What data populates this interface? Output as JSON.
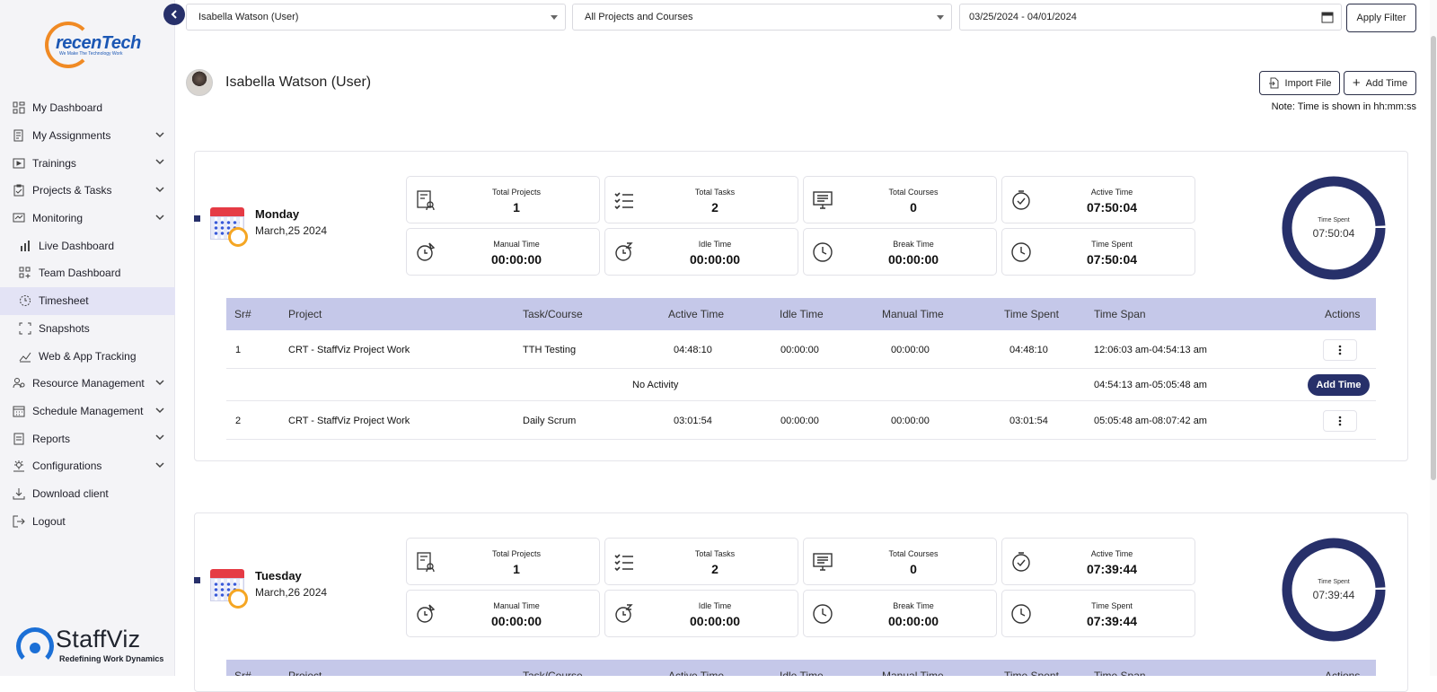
{
  "brand": {
    "logo_text": "recenTech",
    "logo_tagline": "We Make The Technology Work",
    "footer_name": "StaffViz",
    "footer_tagline": "Redefining Work Dynamics"
  },
  "sidebar": {
    "items": [
      {
        "label": "My Dashboard",
        "icon": "dashboard-icon"
      },
      {
        "label": "My Assignments",
        "icon": "assignments-icon"
      },
      {
        "label": "Trainings",
        "icon": "play-icon"
      },
      {
        "label": "Projects & Tasks",
        "icon": "clipboard-icon"
      },
      {
        "label": "Monitoring",
        "icon": "monitor-icon"
      },
      {
        "label": "Live Dashboard",
        "icon": "bar-chart-icon"
      },
      {
        "label": "Team Dashboard",
        "icon": "grid-plus-icon"
      },
      {
        "label": "Timesheet",
        "icon": "timer-icon"
      },
      {
        "label": "Snapshots",
        "icon": "crop-icon"
      },
      {
        "label": "Web & App Tracking",
        "icon": "tracking-icon"
      },
      {
        "label": "Resource Management",
        "icon": "people-icon"
      },
      {
        "label": "Schedule Management",
        "icon": "calendar-icon"
      },
      {
        "label": "Reports",
        "icon": "report-icon"
      },
      {
        "label": "Configurations",
        "icon": "config-icon"
      },
      {
        "label": "Download client",
        "icon": "download-icon"
      },
      {
        "label": "Logout",
        "icon": "logout-icon"
      }
    ]
  },
  "filters": {
    "user": "Isabella Watson (User)",
    "project": "All Projects and Courses",
    "date_range": "03/25/2024 - 04/01/2024",
    "apply_label": "Apply Filter"
  },
  "header": {
    "user_name": "Isabella Watson (User)",
    "import_label": "Import File",
    "add_label": "Add Time",
    "note": "Note: Time is shown in hh:mm:ss"
  },
  "stat_labels": {
    "projects": "Total Projects",
    "tasks": "Total Tasks",
    "courses": "Total Courses",
    "active": "Active Time",
    "manual": "Manual Time",
    "idle": "Idle Time",
    "break": "Break Time",
    "spent": "Time Spent"
  },
  "columns": [
    "Sr#",
    "Project",
    "Task/Course",
    "Active Time",
    "Idle Time",
    "Manual Time",
    "Time Spent",
    "Time Span",
    "Actions"
  ],
  "days": [
    {
      "day": "Monday",
      "date": "March,25 2024",
      "stats": {
        "projects": "1",
        "tasks": "2",
        "courses": "0",
        "active": "07:50:04",
        "manual": "00:00:00",
        "idle": "00:00:00",
        "break": "00:00:00",
        "spent": "07:50:04"
      },
      "donut": {
        "label": "Time Spent",
        "value": "07:50:04"
      },
      "rows": [
        {
          "sr": "1",
          "project": "CRT - StaffViz Project Work",
          "task": "TTH Testing",
          "active": "04:48:10",
          "idle": "00:00:00",
          "manual": "00:00:00",
          "spent": "04:48:10",
          "span": "12:06:03 am-04:54:13 am"
        },
        {
          "no_activity": "No Activity",
          "span": "04:54:13 am-05:05:48 am",
          "action": "Add Time"
        },
        {
          "sr": "2",
          "project": "CRT - StaffViz Project Work",
          "task": "Daily Scrum",
          "active": "03:01:54",
          "idle": "00:00:00",
          "manual": "00:00:00",
          "spent": "03:01:54",
          "span": "05:05:48 am-08:07:42 am"
        }
      ]
    },
    {
      "day": "Tuesday",
      "date": "March,26 2024",
      "stats": {
        "projects": "1",
        "tasks": "2",
        "courses": "0",
        "active": "07:39:44",
        "manual": "00:00:00",
        "idle": "00:00:00",
        "break": "00:00:00",
        "spent": "07:39:44"
      },
      "donut": {
        "label": "Time Spent",
        "value": "07:39:44"
      }
    }
  ],
  "colors": {
    "accent": "#27306a",
    "table_header": "#c5c8e9",
    "active_nav": "#e3e3f5"
  }
}
